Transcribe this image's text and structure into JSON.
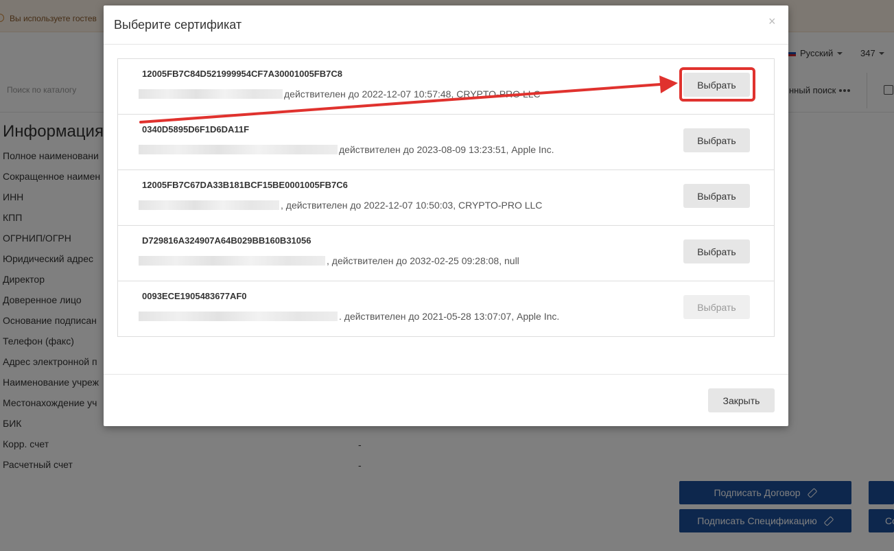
{
  "background": {
    "guest_notice": "Вы используете гостев",
    "language": "Русский",
    "counter": "347",
    "catalog_search_placeholder": "Поиск по каталогу",
    "advanced_search": "нный поиск",
    "info_title": "Информация",
    "info_fields": [
      "Полное наименовани",
      "Сокращенное наимен",
      "ИНН",
      "КПП",
      "ОГРНИП/ОГРН",
      "Юридический адрес",
      "Директор",
      "Доверенное лицо",
      "Основание подписан",
      "Телефон (факс)",
      "Адрес электронной п",
      "Наименование учреж",
      "Местонахождение уч",
      "БИК",
      "Корр. счет",
      "Расчетный счет"
    ],
    "corr_value": "-",
    "account_value": "-",
    "sign_contract": "Подписать Договор",
    "sign_spec": "Подписать Спецификацию",
    "right_partial_label": "Со"
  },
  "modal": {
    "title": "Выберите сертификат",
    "close_icon": "×",
    "close_label": "Закрыть",
    "certificates": [
      {
        "id": "12005FB7C84D521999954CF7A30001005FB7C8",
        "validity": "действителен до 2022-12-07 10:57:48, CRYPTO-PRO LLC",
        "button": "Выбрать",
        "disabled": false
      },
      {
        "id": "0340D5895D6F1D6DA11F",
        "validity": "действителен до 2023-08-09 13:23:51, Apple Inc.",
        "button": "Выбрать",
        "disabled": false
      },
      {
        "id": "12005FB7C67DA33B181BCF15BE0001005FB7C6",
        "validity": ", действителен до 2022-12-07 10:50:03, CRYPTO-PRO LLC",
        "button": "Выбрать",
        "disabled": false
      },
      {
        "id": "D729816A324907A64B029BB160B31056",
        "validity": ", действителен до 2032-02-25 09:28:08, null",
        "button": "Выбрать",
        "disabled": false
      },
      {
        "id": "0093ECE1905483677AF0",
        "validity": ". действителен до 2021-05-28 13:07:07, Apple Inc.",
        "button": "Выбрать",
        "disabled": true
      }
    ]
  },
  "colors": {
    "primary_blue": "#1b4e9b",
    "highlight_red": "#e0322e",
    "button_gray": "#e6e6e6"
  }
}
